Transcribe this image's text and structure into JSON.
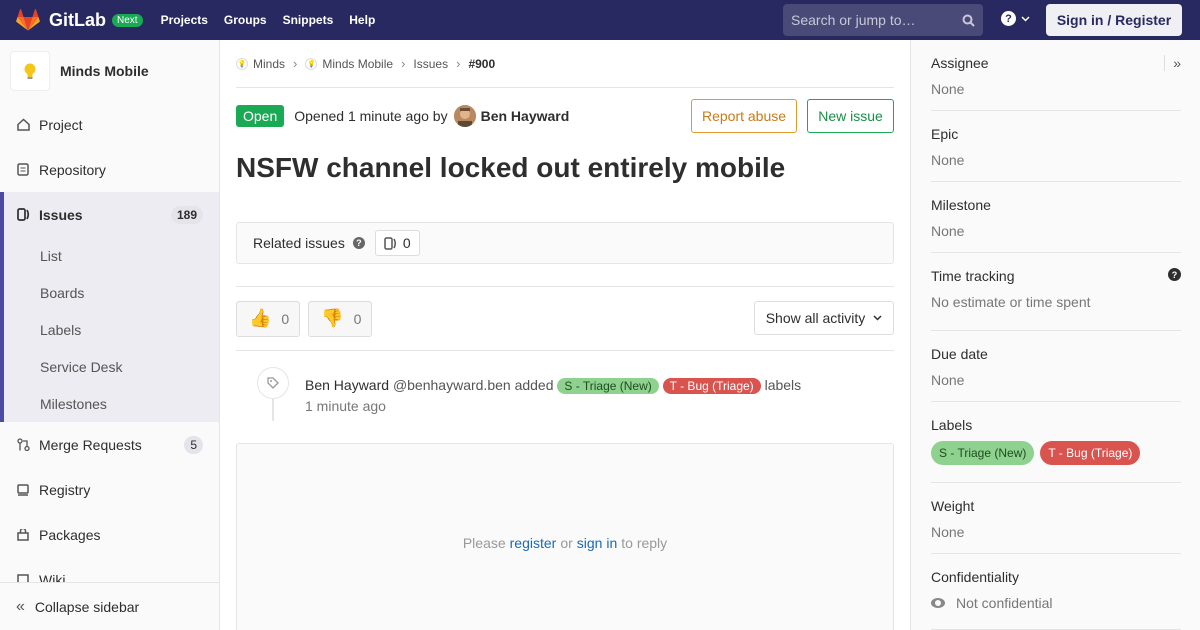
{
  "nav": {
    "brand": "GitLab",
    "badge": "Next",
    "links": [
      "Projects",
      "Groups",
      "Snippets",
      "Help"
    ],
    "search_placeholder": "Search or jump to…",
    "signin": "Sign in / Register"
  },
  "sidebar": {
    "project_name": "Minds Mobile",
    "items": [
      {
        "label": "Project",
        "icon": "home-icon"
      },
      {
        "label": "Repository",
        "icon": "doc-icon"
      },
      {
        "label": "Issues",
        "icon": "issues-icon",
        "count": "189"
      }
    ],
    "issue_subitems": [
      "List",
      "Boards",
      "Labels",
      "Service Desk",
      "Milestones"
    ],
    "more_items": [
      {
        "label": "Merge Requests",
        "icon": "merge-icon",
        "count": "5"
      },
      {
        "label": "Registry",
        "icon": "registry-icon"
      },
      {
        "label": "Packages",
        "icon": "package-icon"
      },
      {
        "label": "Wiki",
        "icon": "book-icon"
      }
    ],
    "collapse": "Collapse sidebar"
  },
  "breadcrumb": {
    "items": [
      "Minds",
      "Minds Mobile",
      "Issues"
    ],
    "current": "#900"
  },
  "issue": {
    "status": "Open",
    "opened_text": "Opened 1 minute ago by",
    "author": "Ben Hayward",
    "report_abuse": "Report abuse",
    "new_issue": "New issue",
    "title": "NSFW channel locked out entirely mobile",
    "related_label": "Related issues",
    "related_count": "0",
    "thumbs_up_count": "0",
    "thumbs_down_count": "0",
    "activity_filter": "Show all activity"
  },
  "note": {
    "author": "Ben Hayward",
    "handle": "@benhayward.ben",
    "action": "added",
    "label1": "S - Triage (New)",
    "label2": "T - Bug (Triage)",
    "suffix": "labels",
    "time": "1 minute ago"
  },
  "reply": {
    "prefix": "Please",
    "register": "register",
    "or": "or",
    "signin": "sign in",
    "suffix": "to reply"
  },
  "right": {
    "assignee_title": "Assignee",
    "assignee_value": "None",
    "epic_title": "Epic",
    "epic_value": "None",
    "milestone_title": "Milestone",
    "milestone_value": "None",
    "time_title": "Time tracking",
    "time_value": "No estimate or time spent",
    "due_title": "Due date",
    "due_value": "None",
    "labels_title": "Labels",
    "label1": "S - Triage (New)",
    "label2": "T - Bug (Triage)",
    "weight_title": "Weight",
    "weight_value": "None",
    "conf_title": "Confidentiality",
    "conf_value": "Not confidential"
  },
  "colors": {
    "navbar": "#292961",
    "open_green": "#1aaa55",
    "label_green": "#8fd18f",
    "label_red": "#d9534f",
    "link_blue": "#1b69b6"
  }
}
